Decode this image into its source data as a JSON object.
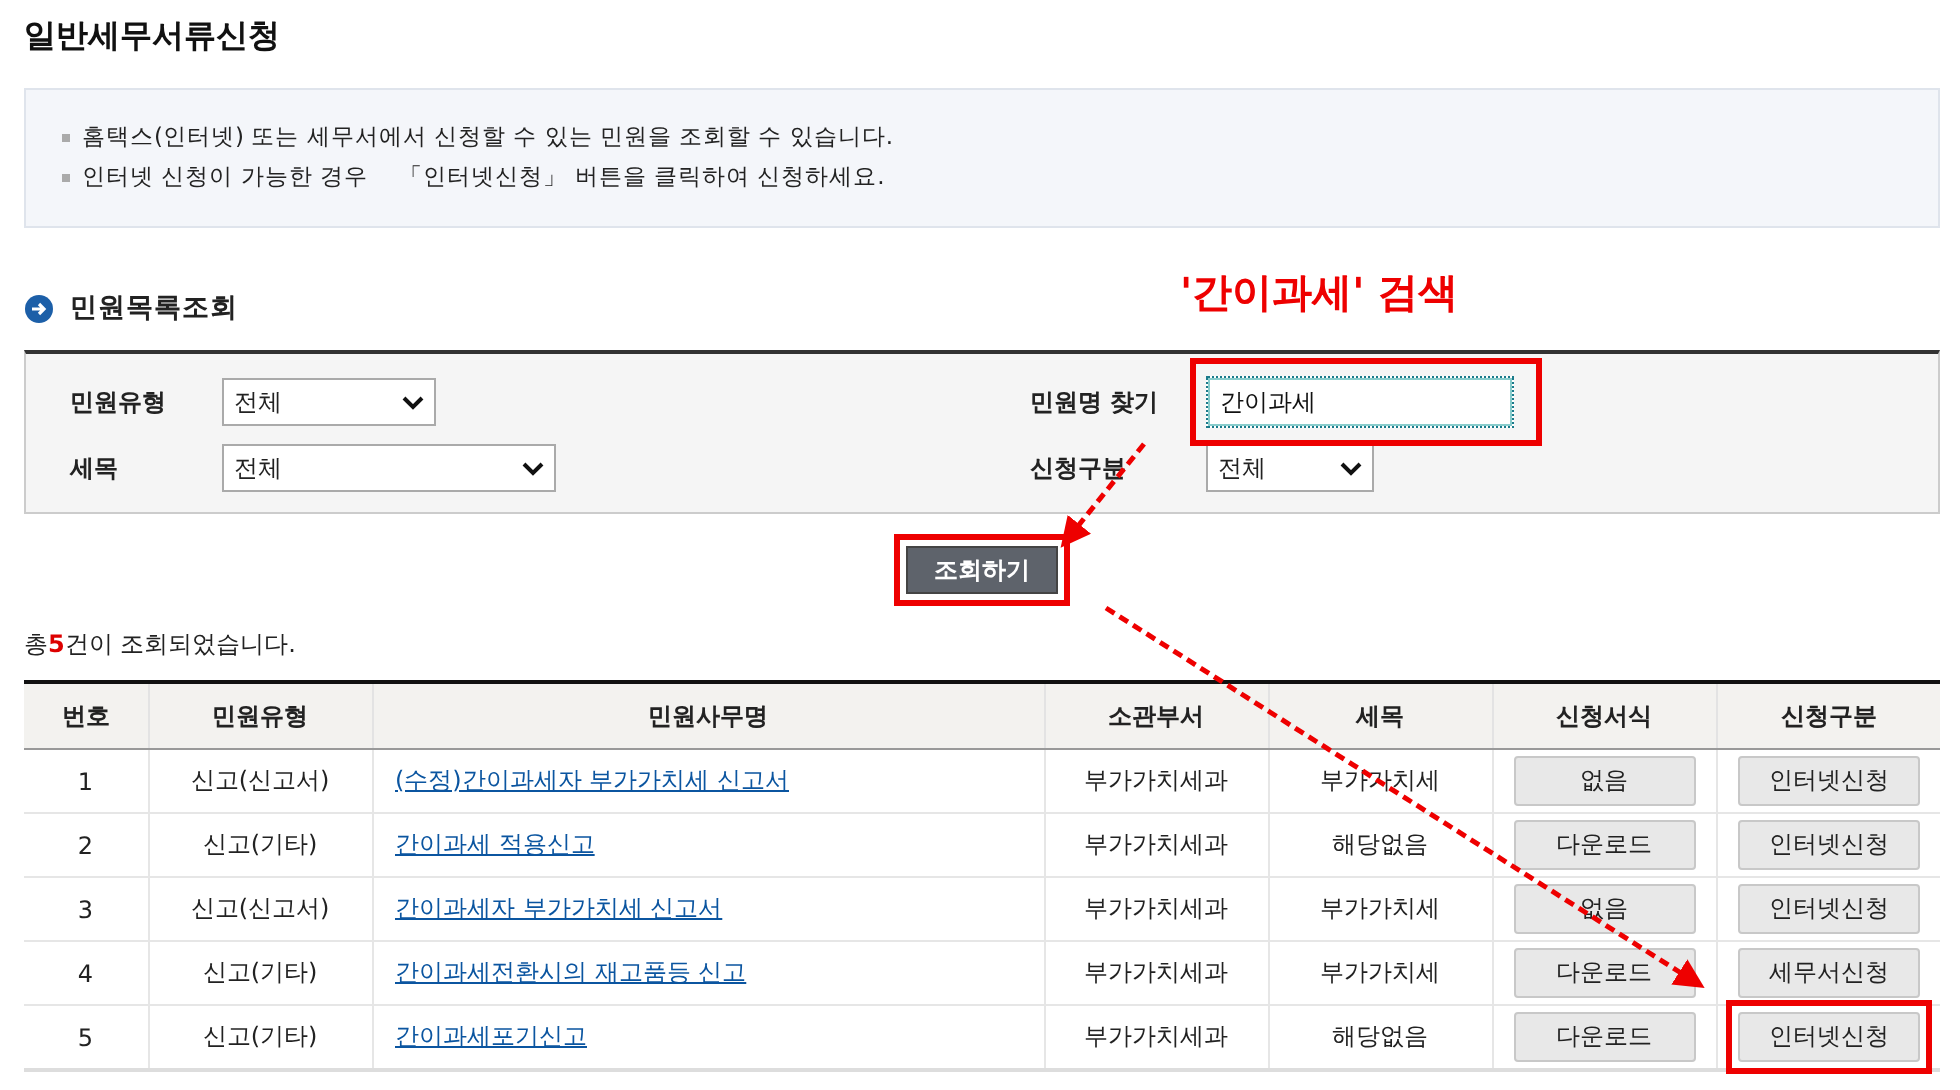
{
  "page_title": "일반세무서류신청",
  "notices": [
    "홈택스(인터넷) 또는 세무서에서 신청할 수 있는 민원을 조회할 수 있습니다.",
    "인터넷 신청이 가능한 경우 　「인터넷신청」 버튼을 클릭하여 신청하세요."
  ],
  "section_title": "민원목록조회",
  "annotation": {
    "label": "'간이과세' 검색"
  },
  "search": {
    "filters": [
      {
        "kind": "select",
        "label": "민원유형",
        "value": "전체"
      },
      {
        "kind": "input",
        "label": "민원명 찾기",
        "value": "간이과세",
        "highlighted": true
      },
      {
        "kind": "select",
        "label": "세목",
        "value": "전체"
      },
      {
        "kind": "select",
        "label": "신청구분",
        "value": "전체"
      }
    ],
    "button": {
      "label": "조회하기",
      "highlighted": true
    }
  },
  "result_count": "총**5**건이 조회되었습니다.",
  "table": {
    "columns": [
      "번호",
      "민원유형",
      "민원사무명",
      "소관부서",
      "세목",
      "신청서식",
      "신청구분"
    ],
    "rows": [
      {
        "no": "1",
        "type": "신고(신고서)",
        "name": "(수정)간이과세자 부가가치세 신고서",
        "dept": "부가가치세과",
        "tax": "부가가치세",
        "form": "없음",
        "apply": {
          "label": "인터넷신청",
          "highlighted": false
        }
      },
      {
        "no": "2",
        "type": "신고(기타)",
        "name": "간이과세 적용신고",
        "dept": "부가가치세과",
        "tax": "해당없음",
        "form": "다운로드",
        "apply": {
          "label": "인터넷신청",
          "highlighted": false
        }
      },
      {
        "no": "3",
        "type": "신고(신고서)",
        "name": "간이과세자 부가가치세 신고서",
        "dept": "부가가치세과",
        "tax": "부가가치세",
        "form": "없음",
        "apply": {
          "label": "인터넷신청",
          "highlighted": false
        }
      },
      {
        "no": "4",
        "type": "신고(기타)",
        "name": "간이과세전환시의 재고품등 신고",
        "dept": "부가가치세과",
        "tax": "부가가치세",
        "form": "다운로드",
        "apply": {
          "label": "세무서신청",
          "highlighted": false
        }
      },
      {
        "no": "5",
        "type": "신고(기타)",
        "name": "간이과세포기신고",
        "dept": "부가가치세과",
        "tax": "해당없음",
        "form": "다운로드",
        "apply": {
          "label": "인터넷신청",
          "highlighted": true
        }
      }
    ]
  }
}
